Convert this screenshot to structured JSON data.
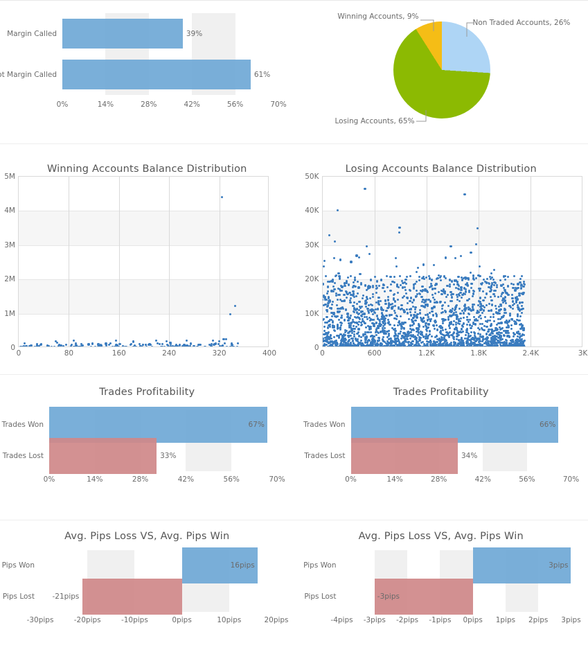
{
  "colors": {
    "bar_blue": "#6fa8d6",
    "bar_red": "#cf8889",
    "band_gray": "#f0f0f0",
    "scatter_blue": "#3b7cbf",
    "pie_non_traded": "#aed5f5",
    "pie_winning": "#f5bd16",
    "pie_losing": "#8cba02",
    "text_gray": "#6b6b6b",
    "title_gray": "#555555"
  },
  "panels": {
    "margin_called": {
      "title": "",
      "categories": [
        "Margin Called",
        "Not Margin Called"
      ],
      "values": [
        39,
        61
      ],
      "value_labels": [
        "39%",
        "61%"
      ],
      "xticks": [
        "0%",
        "14%",
        "28%",
        "42%",
        "56%",
        "70%"
      ],
      "xtick_values": [
        0,
        14,
        28,
        42,
        56,
        70
      ]
    },
    "accounts_pie": {
      "slices": [
        {
          "label": "Non Traded Accounts, 26%",
          "name": "Non Traded Accounts",
          "value": 26,
          "color": "#aed5f5"
        },
        {
          "label": "Losing Accounts, 65%",
          "name": "Losing Accounts",
          "value": 65,
          "color": "#8cba02"
        },
        {
          "label": "Winning Accounts, 9%",
          "name": "Winning Accounts",
          "value": 9,
          "color": "#f5bd16"
        }
      ]
    },
    "winning_scatter": {
      "title": "Winning Accounts Balance Distribution",
      "yticks": [
        "0",
        "1M",
        "2M",
        "3M",
        "4M",
        "5M"
      ],
      "ytick_values": [
        0,
        1000000,
        2000000,
        3000000,
        4000000,
        5000000
      ],
      "xticks": [
        "0",
        "80",
        "160",
        "240",
        "320",
        "400"
      ],
      "xtick_values": [
        0,
        80,
        160,
        240,
        320,
        400
      ],
      "xlim": [
        0,
        400
      ],
      "ylim": [
        0,
        5000000
      ],
      "n_points": 360
    },
    "losing_scatter": {
      "title": "Losing Accounts Balance Distribution",
      "yticks": [
        "0",
        "10K",
        "20K",
        "30K",
        "40K",
        "50K"
      ],
      "ytick_values": [
        0,
        10000,
        20000,
        30000,
        40000,
        50000
      ],
      "xticks": [
        "0",
        "600",
        "1.2K",
        "1.8K",
        "2.4K",
        "3K"
      ],
      "xtick_values": [
        0,
        600,
        1200,
        1800,
        2400,
        3000
      ],
      "xlim": [
        0,
        3000
      ],
      "ylim": [
        0,
        50000
      ],
      "n_points": 2300
    },
    "trades_profitability_left": {
      "title": "Trades Profitability",
      "categories": [
        "Trades Won",
        "Trades Lost"
      ],
      "values": [
        67,
        33
      ],
      "value_labels": [
        "67%",
        "33%"
      ],
      "xticks": [
        "0%",
        "14%",
        "28%",
        "42%",
        "56%",
        "70%"
      ],
      "xtick_values": [
        0,
        14,
        28,
        42,
        56,
        70
      ]
    },
    "trades_profitability_right": {
      "title": "Trades Profitability",
      "categories": [
        "Trades Won",
        "Trades Lost"
      ],
      "values": [
        66,
        34
      ],
      "value_labels": [
        "66%",
        "34%"
      ],
      "xticks": [
        "0%",
        "14%",
        "28%",
        "42%",
        "56%",
        "70%"
      ],
      "xtick_values": [
        0,
        14,
        28,
        42,
        56,
        70
      ]
    },
    "pips_left": {
      "title": "Avg. Pips Loss VS, Avg. Pips Win",
      "categories": [
        "Pips Won",
        "Pips Lost"
      ],
      "values": [
        16,
        -21
      ],
      "value_labels": [
        "16pips",
        "-21pips"
      ],
      "xticks": [
        "-30pips",
        "-20pips",
        "-10pips",
        "0pips",
        "10pips",
        "20pips"
      ],
      "xtick_values": [
        -30,
        -20,
        -10,
        0,
        10,
        20
      ]
    },
    "pips_right": {
      "title": "Avg. Pips Loss VS, Avg. Pips Win",
      "categories": [
        "Pips Won",
        "Pips Lost"
      ],
      "values": [
        3,
        -3
      ],
      "value_labels": [
        "3pips",
        "-3pips"
      ],
      "xticks": [
        "-4pips",
        "-3pips",
        "-2pips",
        "-1pips",
        "0pips",
        "1pips",
        "2pips",
        "3pips"
      ],
      "xtick_values": [
        -4,
        -3,
        -2,
        -1,
        0,
        1,
        2,
        3
      ]
    }
  },
  "chart_data": [
    {
      "type": "bar",
      "orientation": "horizontal",
      "title": "",
      "categories": [
        "Margin Called",
        "Not Margin Called"
      ],
      "values": [
        39,
        61
      ],
      "unit": "%",
      "xlabel": "",
      "ylabel": "",
      "xlim": [
        0,
        70
      ],
      "xticks": [
        0,
        14,
        28,
        42,
        56,
        70
      ],
      "grid": "alternating-vertical-bands",
      "legend": "none",
      "series_color": "#6fa8d6"
    },
    {
      "type": "pie",
      "title": "",
      "labels": [
        "Non Traded Accounts",
        "Losing Accounts",
        "Winning Accounts"
      ],
      "values": [
        26,
        65,
        9
      ],
      "colors": [
        "#aed5f5",
        "#8cba02",
        "#f5bd16"
      ],
      "annotations": [
        "Non Traded Accounts, 26%",
        "Losing Accounts, 65%",
        "Winning Accounts, 9%"
      ],
      "legend": "callout-labels"
    },
    {
      "type": "scatter",
      "title": "Winning Accounts Balance Distribution",
      "xlabel": "",
      "ylabel": "",
      "xlim": [
        0,
        400
      ],
      "ylim": [
        0,
        5000000
      ],
      "xticks": [
        0,
        80,
        160,
        240,
        320,
        400
      ],
      "yticks": [
        0,
        1000000,
        2000000,
        3000000,
        4000000,
        5000000
      ],
      "ytick_labels": [
        "0",
        "1M",
        "2M",
        "3M",
        "4M",
        "5M"
      ],
      "grid": true,
      "point_color": "#3b7cbf",
      "notable_points": [
        {
          "x": 324,
          "y": 4400000
        },
        {
          "x": 345,
          "y": 1220000
        },
        {
          "x": 338,
          "y": 980000
        },
        {
          "x": 327,
          "y": 260000
        },
        {
          "x": 331,
          "y": 260000
        },
        {
          "x": 310,
          "y": 215000
        },
        {
          "x": 236,
          "y": 195000
        },
        {
          "x": 155,
          "y": 215000
        }
      ],
      "description": "Approximately 360 winning accounts, nearly all balances below 250K with a few outliers above 1M"
    },
    {
      "type": "scatter",
      "title": "Losing Accounts Balance Distribution",
      "xlabel": "",
      "ylabel": "",
      "xlim": [
        0,
        3000
      ],
      "ylim": [
        0,
        50000
      ],
      "xticks": [
        0,
        600,
        1200,
        1800,
        2400,
        3000
      ],
      "xtick_labels": [
        "0",
        "600",
        "1.2K",
        "1.8K",
        "2.4K",
        "3K"
      ],
      "yticks": [
        0,
        10000,
        20000,
        30000,
        40000,
        50000
      ],
      "ytick_labels": [
        "0",
        "10K",
        "20K",
        "30K",
        "40K",
        "50K"
      ],
      "grid": true,
      "point_color": "#3b7cbf",
      "notable_points": [
        {
          "x": 490,
          "y": 46500
        },
        {
          "x": 1640,
          "y": 44800
        },
        {
          "x": 175,
          "y": 40100
        },
        {
          "x": 890,
          "y": 35100
        },
        {
          "x": 1790,
          "y": 34900
        },
        {
          "x": 885,
          "y": 33700
        },
        {
          "x": 80,
          "y": 32900
        },
        {
          "x": 145,
          "y": 31100
        },
        {
          "x": 510,
          "y": 29700
        },
        {
          "x": 1480,
          "y": 29700
        },
        {
          "x": 1770,
          "y": 30200
        }
      ],
      "description": "Approximately 2300 losing accounts densely clustered under 20K, extending to about x=2300"
    },
    {
      "type": "bar",
      "orientation": "horizontal",
      "title": "Trades Profitability",
      "categories": [
        "Trades Won",
        "Trades Lost"
      ],
      "values": [
        67,
        33
      ],
      "unit": "%",
      "xlim": [
        0,
        70
      ],
      "xticks": [
        0,
        14,
        28,
        42,
        56,
        70
      ],
      "colors": [
        "#6fa8d6",
        "#cf8889"
      ]
    },
    {
      "type": "bar",
      "orientation": "horizontal",
      "title": "Trades Profitability",
      "categories": [
        "Trades Won",
        "Trades Lost"
      ],
      "values": [
        66,
        34
      ],
      "unit": "%",
      "xlim": [
        0,
        70
      ],
      "xticks": [
        0,
        14,
        28,
        42,
        56,
        70
      ],
      "colors": [
        "#6fa8d6",
        "#cf8889"
      ]
    },
    {
      "type": "bar",
      "orientation": "horizontal",
      "title": "Avg. Pips Loss VS, Avg. Pips Win",
      "categories": [
        "Pips Won",
        "Pips Lost"
      ],
      "values": [
        16,
        -21
      ],
      "unit": "pips",
      "xlim": [
        -30,
        20
      ],
      "xticks": [
        -30,
        -20,
        -10,
        0,
        10,
        20
      ],
      "colors": [
        "#6fa8d6",
        "#cf8889"
      ]
    },
    {
      "type": "bar",
      "orientation": "horizontal",
      "title": "Avg. Pips Loss VS, Avg. Pips Win",
      "categories": [
        "Pips Won",
        "Pips Lost"
      ],
      "values": [
        3,
        -3
      ],
      "unit": "pips",
      "xlim": [
        -4,
        3
      ],
      "xticks": [
        -4,
        -3,
        -2,
        -1,
        0,
        1,
        2,
        3
      ],
      "colors": [
        "#6fa8d6",
        "#cf8889"
      ]
    }
  ]
}
